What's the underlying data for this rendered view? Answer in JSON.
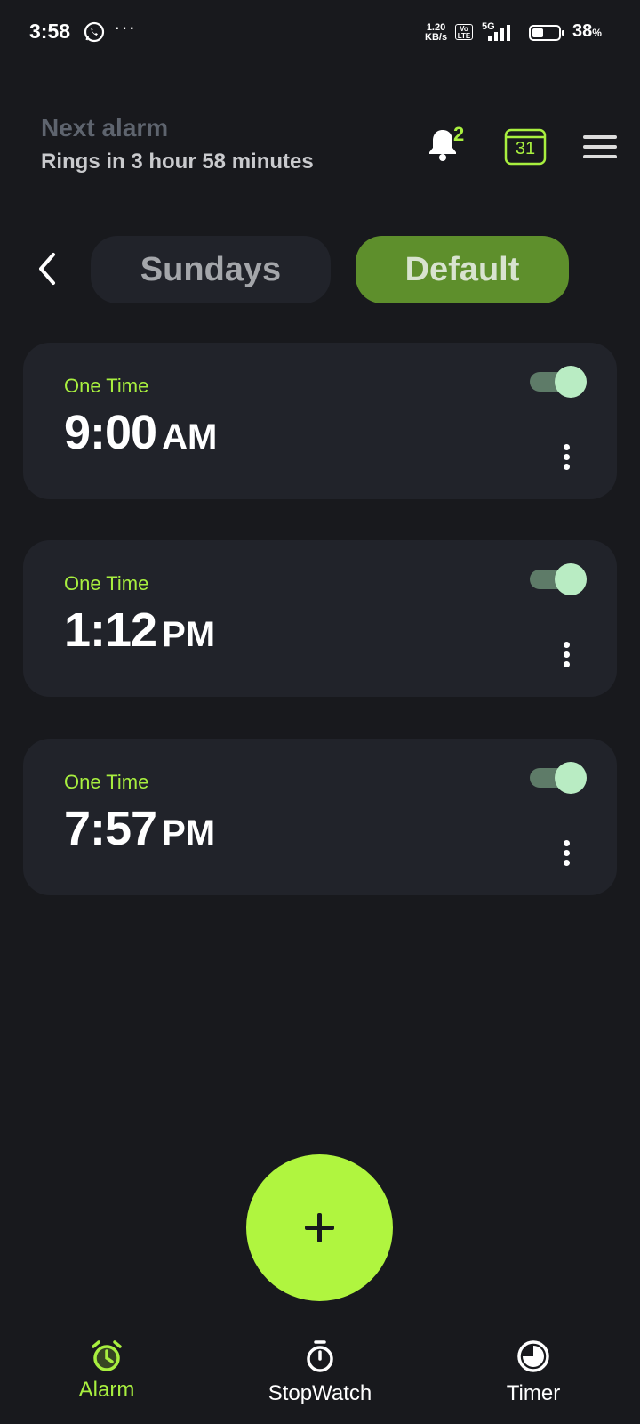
{
  "status_bar": {
    "time": "3:58",
    "net_speed_value": "1.20",
    "net_speed_unit": "KB/s",
    "volte_top": "Vo",
    "volte_bottom": "LTE",
    "network": "5G",
    "battery_value": "38",
    "battery_unit": "%"
  },
  "header": {
    "next_alarm_label": "Next alarm",
    "next_alarm_sub": "Rings in 3 hour 58 minutes",
    "notification_count": "2",
    "calendar_day": "31"
  },
  "tabs": {
    "items": [
      {
        "label": "Sundays",
        "active": false
      },
      {
        "label": "Default",
        "active": true
      }
    ]
  },
  "alarms": [
    {
      "type": "One Time",
      "time": "9:00",
      "ampm": "AM",
      "enabled": true
    },
    {
      "type": "One Time",
      "time": "1:12",
      "ampm": "PM",
      "enabled": true
    },
    {
      "type": "One Time",
      "time": "7:57",
      "ampm": "PM",
      "enabled": true
    }
  ],
  "bottom_nav": {
    "items": [
      {
        "label": "Alarm",
        "icon": "alarm-clock-icon",
        "active": true
      },
      {
        "label": "StopWatch",
        "icon": "stopwatch-icon",
        "active": false
      },
      {
        "label": "Timer",
        "icon": "timer-icon",
        "active": false
      }
    ]
  },
  "colors": {
    "background": "#18191d",
    "card": "#21232a",
    "accent": "#a8ef3f",
    "fab": "#b0f53f",
    "active_tab": "#5e8f2c"
  }
}
